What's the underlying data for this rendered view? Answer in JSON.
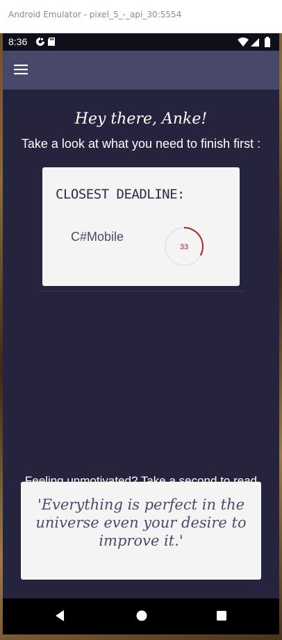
{
  "window": {
    "title": "Android Emulator - pixel_5_-_api_30:5554"
  },
  "status_bar": {
    "time": "8:36",
    "left_icons": [
      "data-saver-icon",
      "sd-card-icon"
    ],
    "right_icons": [
      "wifi-icon",
      "signal-icon",
      "battery-icon"
    ]
  },
  "app_bar": {
    "menu_icon": "hamburger-menu-icon"
  },
  "main": {
    "greeting": "Hey there, Anke!",
    "subtitle": "Take a look at what you need to finish first :",
    "deadline_card": {
      "title": "CLOSEST DEADLINE:",
      "course": "C#Mobile",
      "days_left": "33",
      "progress_fraction": 0.33
    },
    "motivation": {
      "label": "Feeling unmotivated? Take a second to read this :",
      "quote": "'Everything is perfect in the universe even your desire to improve it.'"
    }
  },
  "nav_bar": {
    "back_icon": "back-triangle-icon",
    "home_icon": "home-circle-icon",
    "recents_icon": "recents-square-icon"
  },
  "colors": {
    "background": "#25243f",
    "app_bar": "#47476a",
    "card": "#f4f4f4",
    "progress_arc": "#b22222",
    "progress_track": "#dbe7f5"
  }
}
